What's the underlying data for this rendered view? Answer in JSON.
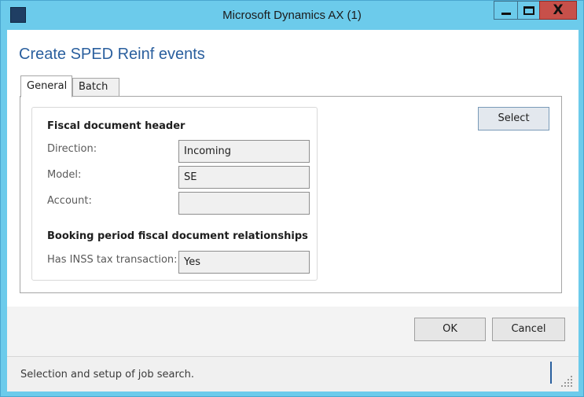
{
  "window": {
    "title": "Microsoft Dynamics AX (1)",
    "app_icon_glyph": "AX",
    "minimize_glyph": "",
    "maximize_glyph": "",
    "close_glyph": "X"
  },
  "form": {
    "title": "Create SPED Reinf events",
    "tabs": [
      {
        "label": "General",
        "active": true
      },
      {
        "label": "Batch",
        "active": false
      }
    ]
  },
  "general": {
    "fiscal_header_title": "Fiscal document header",
    "fields": [
      {
        "label": "Direction:",
        "value": "Incoming"
      },
      {
        "label": "Model:",
        "value": "SE"
      },
      {
        "label": "Account:",
        "value": ""
      }
    ],
    "booking_title": "Booking period fiscal document relationships",
    "inss": {
      "label": "Has INSS tax transaction:",
      "value": "Yes"
    }
  },
  "buttons": {
    "select": "Select",
    "ok": "OK",
    "cancel": "Cancel"
  },
  "status": {
    "text": "Selection and setup of job search."
  },
  "colors": {
    "frame": "#6ccbeb",
    "title_accent": "#2a5f9e",
    "close_button": "#c7504a"
  }
}
